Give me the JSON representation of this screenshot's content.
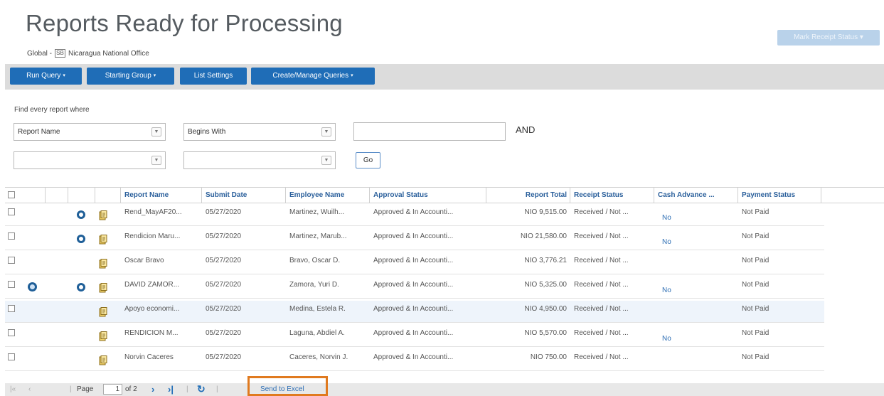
{
  "page": {
    "title": "Reports Ready for Processing",
    "scope": "Global -",
    "office_icon": "SB",
    "office": "Nicaragua National Office",
    "receipt_button": "Mark Receipt Status ▾"
  },
  "toolbar": {
    "buttons": [
      {
        "label": "Run Query",
        "caret": "▾"
      },
      {
        "label": "Starting Group",
        "caret": "▾"
      },
      {
        "label": "List Settings",
        "caret": ""
      },
      {
        "label": "Create/Manage Queries",
        "caret": "▾"
      }
    ]
  },
  "query": {
    "label": "Find every report where",
    "field1": "Report Name",
    "operator1": "Begins With",
    "value1": "",
    "conjunction": "AND",
    "field2": "",
    "operator2": "",
    "go_label": "Go"
  },
  "table": {
    "columns": [
      "Report Name",
      "Submit Date",
      "Employee Name",
      "Approval Status",
      "Report Total",
      "Receipt Status",
      "Cash Advance ...",
      "Payment Status"
    ],
    "rows": [
      {
        "name": "Rend_MayAF20...",
        "date": "05/27/2020",
        "employee": "Martinez, Wuilh...",
        "approval": "Approved & In Accounti...",
        "total": "NIO 9,515.00",
        "receipt": "Received / Not ...",
        "cash": "No",
        "payment": "Not Paid",
        "exception": false,
        "ring": true
      },
      {
        "name": "Rendicion Maru...",
        "date": "05/27/2020",
        "employee": "Martinez, Marub...",
        "approval": "Approved & In Accounti...",
        "total": "NIO 21,580.00",
        "receipt": "Received / Not ...",
        "cash": "No",
        "payment": "Not Paid",
        "exception": false,
        "ring": true
      },
      {
        "name": "Oscar Bravo",
        "date": "05/27/2020",
        "employee": "Bravo, Oscar D.",
        "approval": "Approved & In Accounti...",
        "total": "NIO 3,776.21",
        "receipt": "Received / Not ...",
        "cash": "",
        "payment": "Not Paid",
        "exception": false,
        "ring": false
      },
      {
        "name": "DAVID ZAMOR...",
        "date": "05/27/2020",
        "employee": "Zamora, Yuri D.",
        "approval": "Approved & In Accounti...",
        "total": "NIO 5,325.00",
        "receipt": "Received / Not ...",
        "cash": "No",
        "payment": "Not Paid",
        "exception": true,
        "ring": true
      },
      {
        "name": "Apoyo economi...",
        "date": "05/27/2020",
        "employee": "Medina, Estela R.",
        "approval": "Approved & In Accounti...",
        "total": "NIO 4,950.00",
        "receipt": "Received / Not ...",
        "cash": "",
        "payment": "Not Paid",
        "exception": false,
        "ring": false
      },
      {
        "name": "RENDICION M...",
        "date": "05/27/2020",
        "employee": "Laguna, Abdiel A.",
        "approval": "Approved & In Accounti...",
        "total": "NIO 5,570.00",
        "receipt": "Received / Not ...",
        "cash": "No",
        "payment": "Not Paid",
        "exception": false,
        "ring": false
      },
      {
        "name": "Norvin Caceres",
        "date": "05/27/2020",
        "employee": "Caceres, Norvin J.",
        "approval": "Approved & In Accounti...",
        "total": "NIO 750.00",
        "receipt": "Received / Not ...",
        "cash": "",
        "payment": "Not Paid",
        "exception": false,
        "ring": false
      }
    ]
  },
  "footer": {
    "first": "|«",
    "prev": "‹",
    "page_label": "Page",
    "page_value": "1",
    "of_label": "of 2",
    "next": "›",
    "last": "›|",
    "refresh_icon": "↻",
    "send_label": "Send to Excel"
  },
  "colors": {
    "accent": "#1f6db7",
    "header_text": "#2a5f9b",
    "highlight": "#e07a1f"
  }
}
